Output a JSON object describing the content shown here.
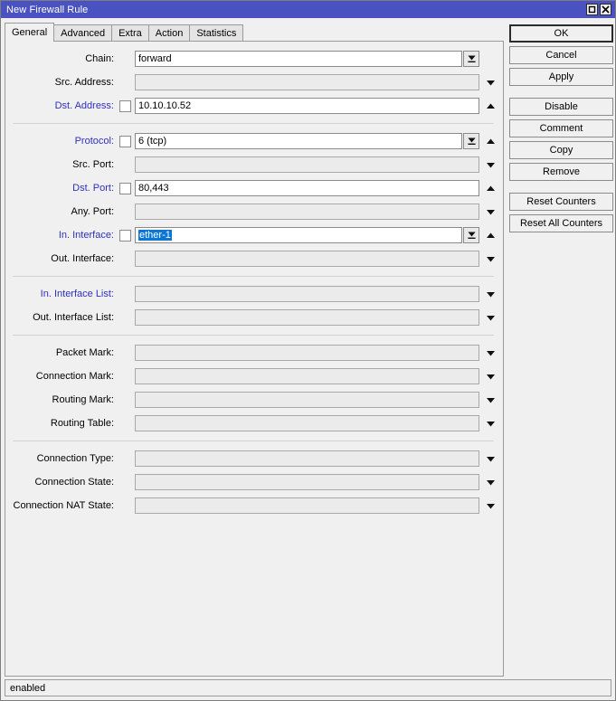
{
  "window": {
    "title": "New Firewall Rule",
    "buttons": [
      {
        "name": "maximize-button",
        "icon": "maximize-icon"
      },
      {
        "name": "close-button",
        "icon": "close-icon"
      }
    ]
  },
  "tabs": [
    {
      "label": "General",
      "active": true
    },
    {
      "label": "Advanced",
      "active": false
    },
    {
      "label": "Extra",
      "active": false
    },
    {
      "label": "Action",
      "active": false
    },
    {
      "label": "Statistics",
      "active": false
    }
  ],
  "groups": [
    {
      "rows": [
        {
          "label": "Chain:",
          "blue": false,
          "checkbox": false,
          "value": "forward",
          "disabled": false,
          "combo": true,
          "arrow": "none"
        },
        {
          "label": "Src. Address:",
          "blue": false,
          "checkbox": false,
          "value": "",
          "disabled": true,
          "combo": false,
          "arrow": "down"
        },
        {
          "label": "Dst. Address:",
          "blue": true,
          "checkbox": true,
          "value": "10.10.10.52",
          "disabled": false,
          "combo": false,
          "arrow": "up"
        }
      ]
    },
    {
      "rows": [
        {
          "label": "Protocol:",
          "blue": true,
          "checkbox": true,
          "value": "6 (tcp)",
          "disabled": false,
          "combo": true,
          "arrow": "up"
        },
        {
          "label": "Src. Port:",
          "blue": false,
          "checkbox": false,
          "value": "",
          "disabled": true,
          "combo": false,
          "arrow": "down"
        },
        {
          "label": "Dst. Port:",
          "blue": true,
          "checkbox": true,
          "value": "80,443",
          "disabled": false,
          "combo": false,
          "arrow": "up"
        },
        {
          "label": "Any. Port:",
          "blue": false,
          "checkbox": false,
          "value": "",
          "disabled": true,
          "combo": false,
          "arrow": "down"
        },
        {
          "label": "In. Interface:",
          "blue": true,
          "checkbox": true,
          "value": "ether-1",
          "selected": true,
          "disabled": false,
          "combo": true,
          "arrow": "up"
        },
        {
          "label": "Out. Interface:",
          "blue": false,
          "checkbox": false,
          "value": "",
          "disabled": true,
          "combo": false,
          "arrow": "down"
        }
      ]
    },
    {
      "rows": [
        {
          "label": "In. Interface List:",
          "blue": true,
          "checkbox": false,
          "value": "",
          "disabled": true,
          "combo": false,
          "arrow": "down"
        },
        {
          "label": "Out. Interface List:",
          "blue": false,
          "checkbox": false,
          "value": "",
          "disabled": true,
          "combo": false,
          "arrow": "down"
        }
      ]
    },
    {
      "rows": [
        {
          "label": "Packet Mark:",
          "blue": false,
          "checkbox": false,
          "value": "",
          "disabled": true,
          "combo": false,
          "arrow": "down"
        },
        {
          "label": "Connection Mark:",
          "blue": false,
          "checkbox": false,
          "value": "",
          "disabled": true,
          "combo": false,
          "arrow": "down"
        },
        {
          "label": "Routing Mark:",
          "blue": false,
          "checkbox": false,
          "value": "",
          "disabled": true,
          "combo": false,
          "arrow": "down"
        },
        {
          "label": "Routing Table:",
          "blue": false,
          "checkbox": false,
          "value": "",
          "disabled": true,
          "combo": false,
          "arrow": "down"
        }
      ]
    },
    {
      "rows": [
        {
          "label": "Connection Type:",
          "blue": false,
          "checkbox": false,
          "value": "",
          "disabled": true,
          "combo": false,
          "arrow": "down"
        },
        {
          "label": "Connection State:",
          "blue": false,
          "checkbox": false,
          "value": "",
          "disabled": true,
          "combo": false,
          "arrow": "down"
        },
        {
          "label": "Connection NAT State:",
          "blue": false,
          "checkbox": false,
          "value": "",
          "disabled": true,
          "combo": false,
          "arrow": "down"
        }
      ]
    }
  ],
  "action_buttons": [
    {
      "label": "OK",
      "default": true,
      "gap": false
    },
    {
      "label": "Cancel",
      "default": false,
      "gap": false
    },
    {
      "label": "Apply",
      "default": false,
      "gap": false
    },
    {
      "label": "Disable",
      "default": false,
      "gap": true
    },
    {
      "label": "Comment",
      "default": false,
      "gap": false
    },
    {
      "label": "Copy",
      "default": false,
      "gap": false
    },
    {
      "label": "Remove",
      "default": false,
      "gap": false
    },
    {
      "label": "Reset Counters",
      "default": false,
      "gap": true
    },
    {
      "label": "Reset All Counters",
      "default": false,
      "gap": false
    }
  ],
  "statusbar": {
    "text": "enabled"
  },
  "colors": {
    "titlebar": "#4a51c0",
    "accent_blue_label": "#2f2fbf",
    "selection_blue": "#0b76d4",
    "window_bg": "#f0f0f0"
  }
}
